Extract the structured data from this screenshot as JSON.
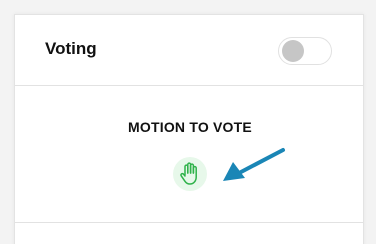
{
  "voting": {
    "label": "Voting",
    "toggle_on": false
  },
  "motion": {
    "title": "MOTION TO VOTE",
    "icon": "raised-hand-icon"
  },
  "annotation": {
    "icon": "pointer-arrow-icon"
  },
  "colors": {
    "hand_bg": "#e7f8ea",
    "hand_stroke": "#2fb24a",
    "arrow": "#1a86b6",
    "knob": "#c6c6c6"
  }
}
